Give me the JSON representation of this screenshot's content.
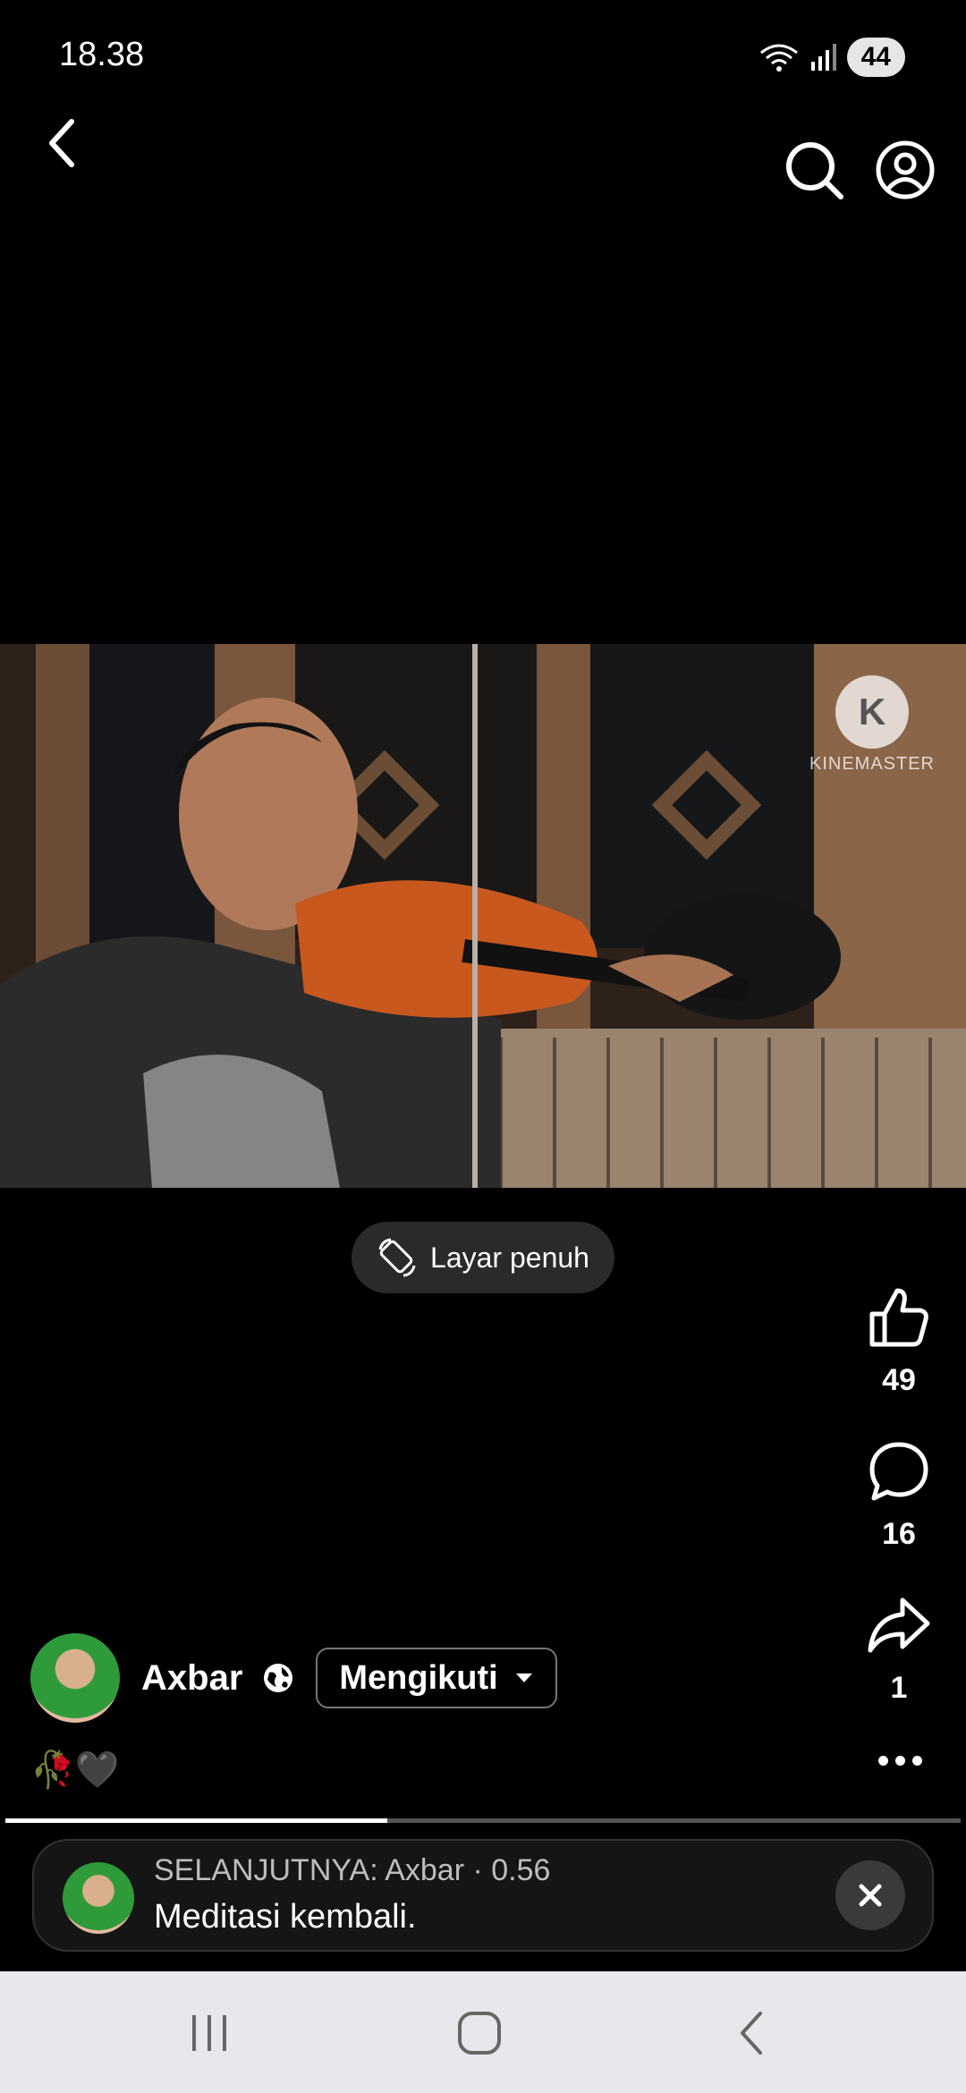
{
  "status_bar": {
    "time": "18.38",
    "battery": "44"
  },
  "video": {
    "watermark": "KINEMASTER",
    "watermark_logo_letter": "K"
  },
  "fullscreen": {
    "label": "Layar penuh"
  },
  "actions": {
    "likes": "49",
    "comments": "16",
    "shares": "1"
  },
  "author": {
    "name": "Axbar",
    "follow_label": "Mengikuti"
  },
  "caption": {
    "text": "🥀🖤"
  },
  "progress": {
    "fraction": 0.4
  },
  "up_next": {
    "subtitle": "SELANJUTNYA: Axbar · 0.56",
    "title": "Meditasi kembali."
  },
  "icons": {
    "back": "chevron-left-icon",
    "search": "search-icon",
    "profile": "user-circle-icon",
    "like": "thumbs-up-icon",
    "comment": "comment-icon",
    "share": "share-icon",
    "globe": "globe-icon",
    "more": "more-horizontal-icon",
    "close": "close-icon"
  }
}
